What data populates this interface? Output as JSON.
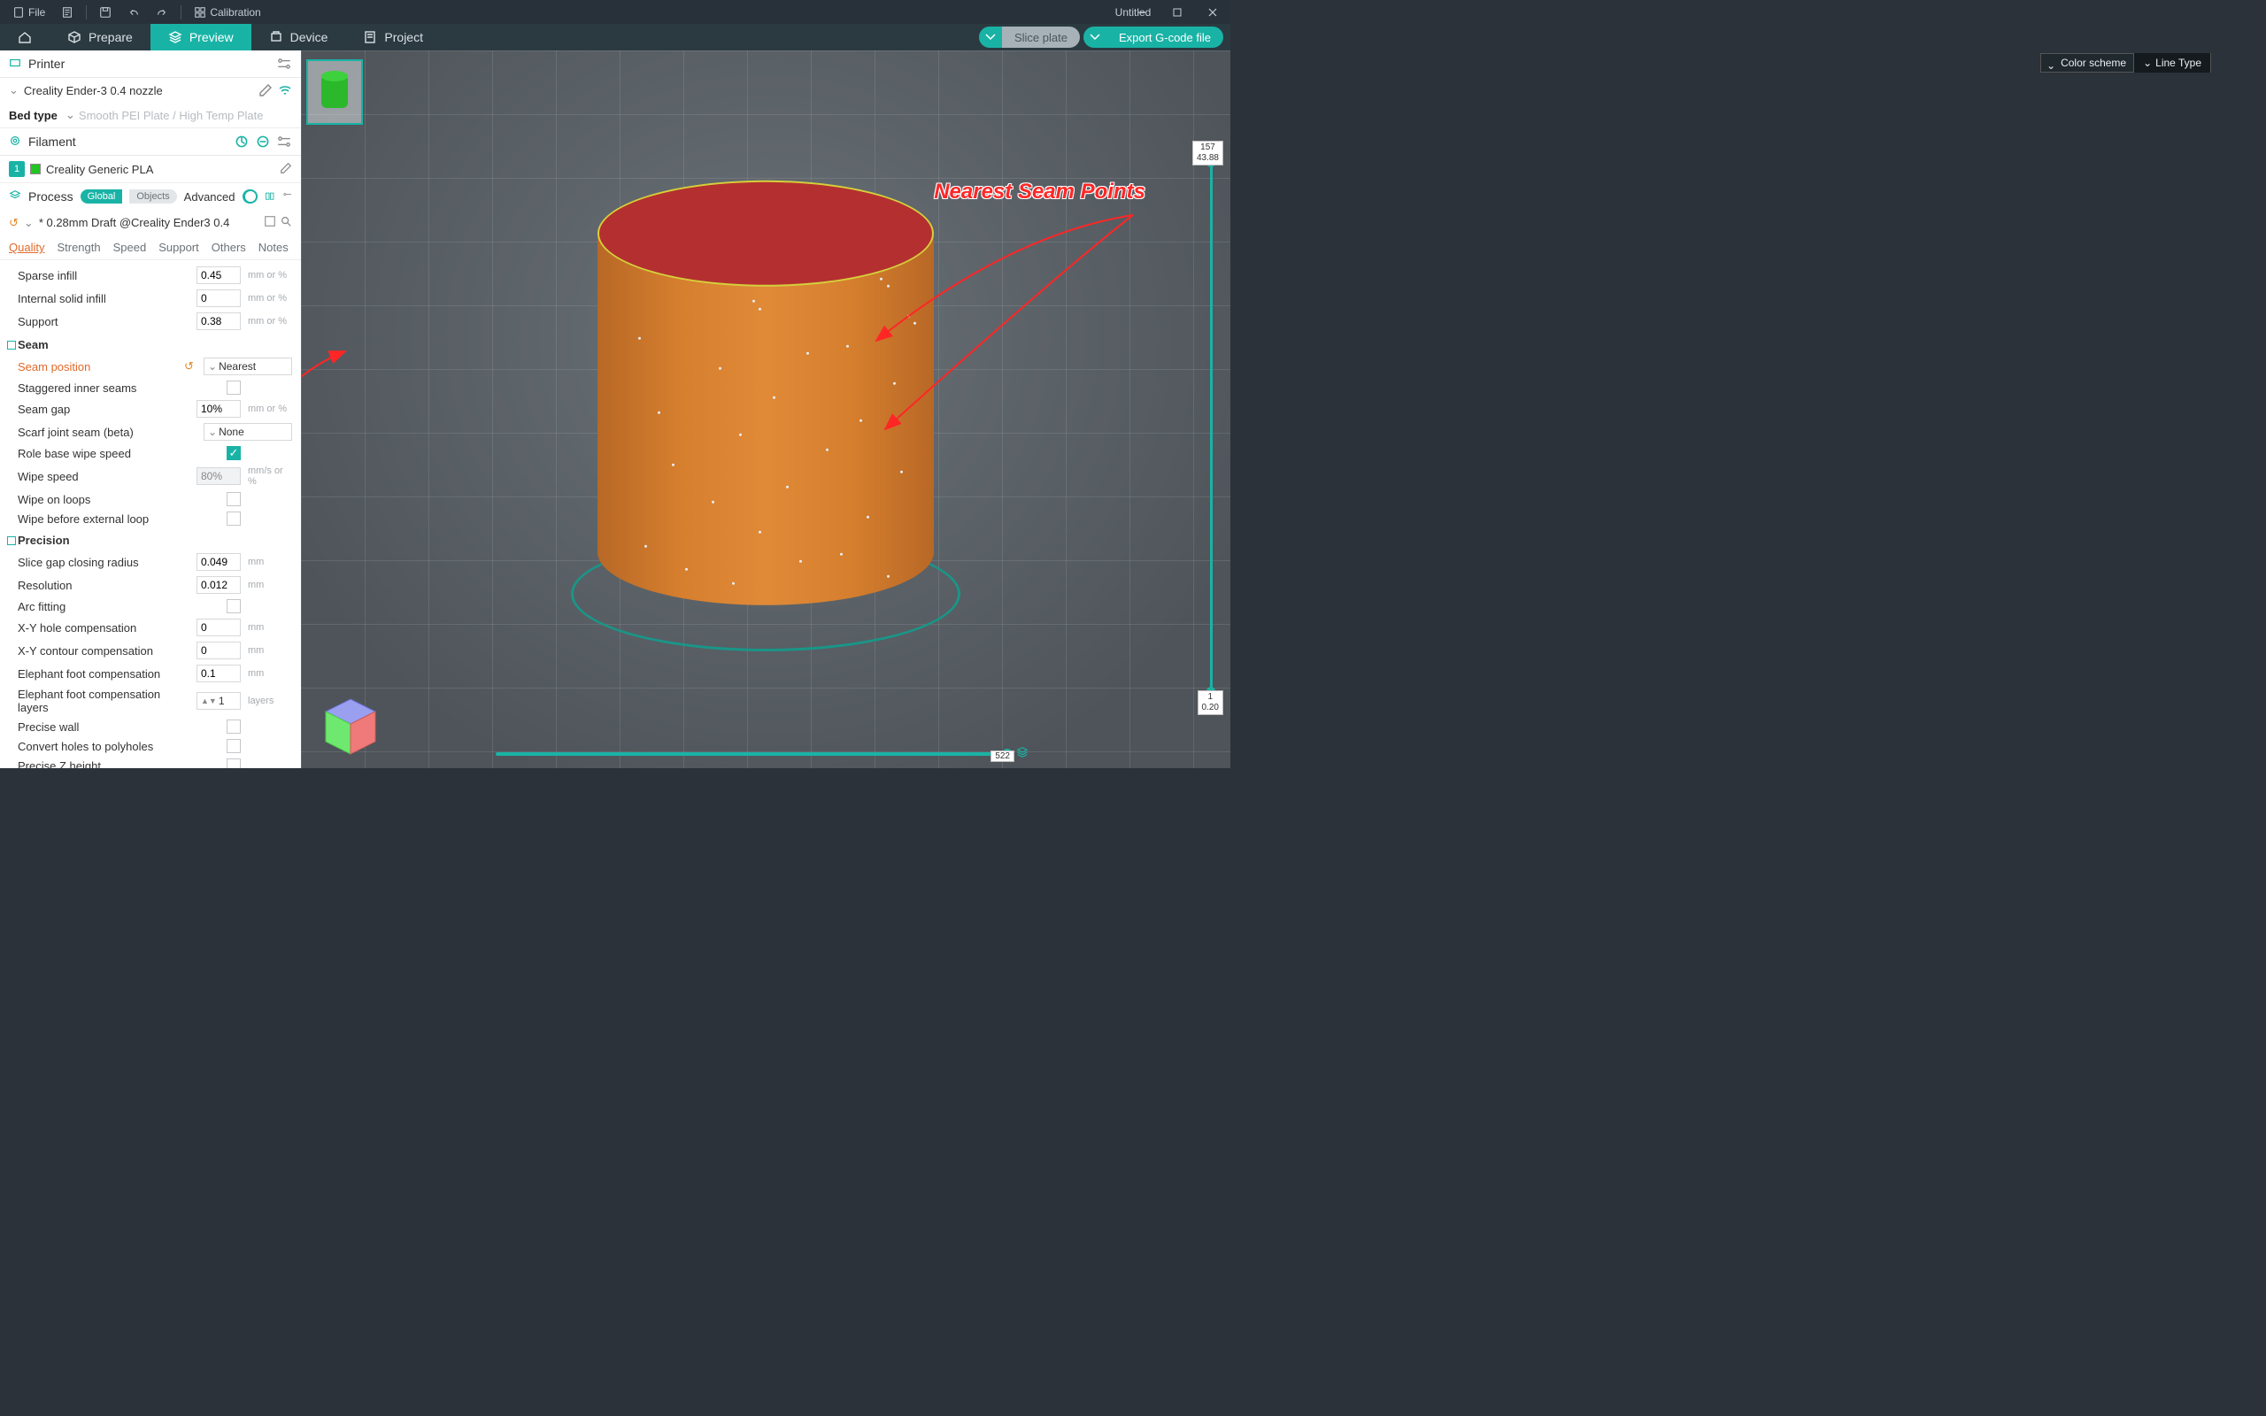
{
  "titlebar": {
    "file": "File",
    "calibration": "Calibration",
    "title": "Untitled"
  },
  "topbar": {
    "prepare": "Prepare",
    "preview": "Preview",
    "device": "Device",
    "project": "Project",
    "slice_plate": "Slice plate",
    "export_gcode": "Export G-code file"
  },
  "color_scheme": {
    "label": "Color scheme",
    "value": "Line Type"
  },
  "sidebar": {
    "printer_header": "Printer",
    "printer_name": "Creality Ender-3 0.4 nozzle",
    "bed_label": "Bed type",
    "bed_value": "Smooth PEI Plate / High Temp Plate",
    "filament_header": "Filament",
    "filament_index": "1",
    "filament_name": "Creality Generic PLA",
    "process_header": "Process",
    "badge_global": "Global",
    "badge_objects": "Objects",
    "advanced": "Advanced",
    "preset_name": "* 0.28mm Draft @Creality Ender3 0.4",
    "tabs": {
      "quality": "Quality",
      "strength": "Strength",
      "speed": "Speed",
      "support": "Support",
      "others": "Others",
      "notes": "Notes"
    }
  },
  "settings": {
    "sparse_infill": {
      "label": "Sparse infill",
      "value": "0.45",
      "unit": "mm or %"
    },
    "internal_solid": {
      "label": "Internal solid infill",
      "value": "0",
      "unit": "mm or %"
    },
    "support": {
      "label": "Support",
      "value": "0.38",
      "unit": "mm or %"
    },
    "seam_group": "Seam",
    "seam_position": {
      "label": "Seam position",
      "value": "Nearest"
    },
    "staggered": {
      "label": "Staggered inner seams"
    },
    "seam_gap": {
      "label": "Seam gap",
      "value": "10%",
      "unit": "mm or %"
    },
    "scarf": {
      "label": "Scarf joint seam (beta)",
      "value": "None"
    },
    "role_wipe": {
      "label": "Role base wipe speed"
    },
    "wipe_speed": {
      "label": "Wipe speed",
      "value": "80%",
      "unit": "mm/s or %"
    },
    "wipe_loops": {
      "label": "Wipe on loops"
    },
    "wipe_before_ext": {
      "label": "Wipe before external loop"
    },
    "precision_group": "Precision",
    "slice_gap": {
      "label": "Slice gap closing radius",
      "value": "0.049",
      "unit": "mm"
    },
    "resolution": {
      "label": "Resolution",
      "value": "0.012",
      "unit": "mm"
    },
    "arc_fitting": {
      "label": "Arc fitting"
    },
    "xy_hole": {
      "label": "X-Y hole compensation",
      "value": "0",
      "unit": "mm"
    },
    "xy_contour": {
      "label": "X-Y contour compensation",
      "value": "0",
      "unit": "mm"
    },
    "elephant": {
      "label": "Elephant foot compensation",
      "value": "0.1",
      "unit": "mm"
    },
    "elephant_layers": {
      "label": "Elephant foot compensation layers",
      "value": "1",
      "unit": "layers"
    },
    "precise_wall": {
      "label": "Precise wall"
    },
    "convert_holes": {
      "label": "Convert holes to polyholes"
    },
    "precise_z": {
      "label": "Precise Z height"
    }
  },
  "ruler": {
    "top_layer": "157",
    "top_mm": "43.88",
    "bot_layer": "1",
    "bot_mm": "0.20",
    "h_val": "522"
  },
  "annotation": "Nearest Seam Points"
}
